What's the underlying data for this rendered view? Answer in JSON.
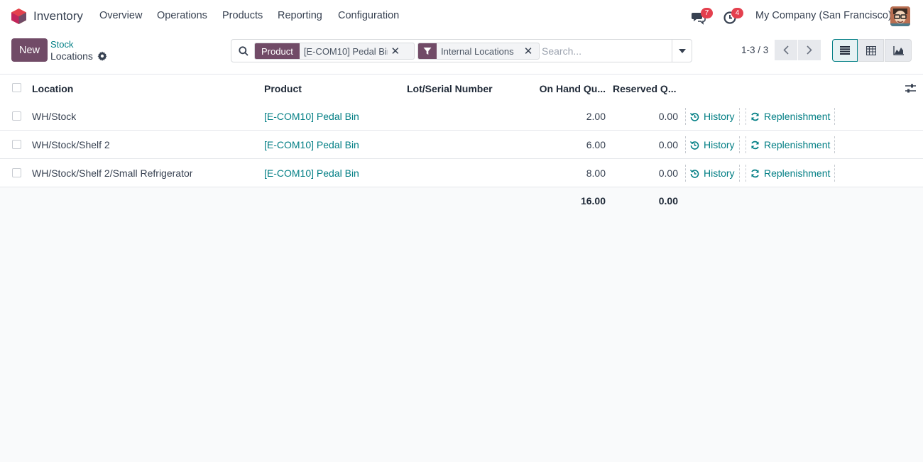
{
  "navbar": {
    "app_name": "Inventory",
    "menus": [
      "Overview",
      "Operations",
      "Products",
      "Reporting",
      "Configuration"
    ],
    "messages_badge": "7",
    "activities_badge": "4",
    "company": "My Company (San Francisco)"
  },
  "control": {
    "new_label": "New",
    "breadcrumb_parent": "Stock",
    "breadcrumb_current": "Locations",
    "search": {
      "facet_product_label": "Product",
      "facet_product_value": "[E-COM10] Pedal Bin",
      "facet_filter_value": "Internal Locations",
      "placeholder": "Search..."
    },
    "pager": "1-3 / 3"
  },
  "table": {
    "columns": [
      "Location",
      "Product",
      "Lot/Serial Number",
      "On Hand Qu...",
      "Reserved Q..."
    ],
    "rows": [
      {
        "location": "WH/Stock",
        "product": "[E-COM10] Pedal Bin",
        "lot": "",
        "on_hand": "2.00",
        "reserved": "0.00",
        "history": "History",
        "replenishment": "Replenishment"
      },
      {
        "location": "WH/Stock/Shelf 2",
        "product": "[E-COM10] Pedal Bin",
        "lot": "",
        "on_hand": "6.00",
        "reserved": "0.00",
        "history": "History",
        "replenishment": "Replenishment"
      },
      {
        "location": "WH/Stock/Shelf 2/Small Refrigerator",
        "product": "[E-COM10] Pedal Bin",
        "lot": "",
        "on_hand": "8.00",
        "reserved": "0.00",
        "history": "History",
        "replenishment": "Replenishment"
      }
    ],
    "totals": {
      "on_hand": "16.00",
      "reserved": "0.00"
    }
  },
  "colors": {
    "brand": "#714b67",
    "link": "#017e84",
    "badge": "#e4404e"
  }
}
